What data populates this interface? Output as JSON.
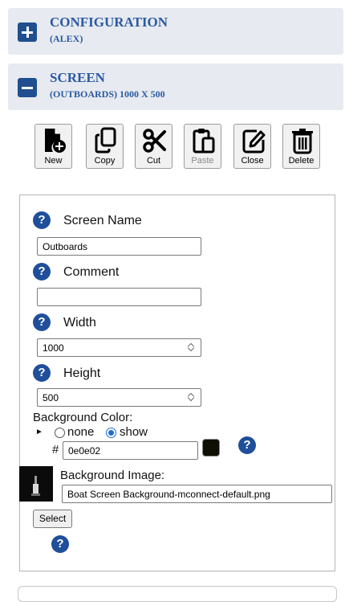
{
  "accordion": {
    "configuration": {
      "title": "CONFIGURATION",
      "subtitle": "(ALEX)",
      "state": "collapsed"
    },
    "screen": {
      "title": "SCREEN",
      "subtitle": "(OUTBOARDS) 1000 X 500",
      "state": "expanded"
    }
  },
  "toolbar": {
    "new_label": "New",
    "copy_label": "Copy",
    "cut_label": "Cut",
    "paste_label": "Paste",
    "close_label": "Close",
    "delete_label": "Delete"
  },
  "form": {
    "help_glyph": "?",
    "screen_name": {
      "label": "Screen Name",
      "value": "Outboards"
    },
    "comment": {
      "label": "Comment",
      "value": ""
    },
    "width": {
      "label": "Width",
      "value": "1000"
    },
    "height": {
      "label": "Height",
      "value": "500"
    },
    "background_color": {
      "label": "Background Color:",
      "expand_glyph": "►",
      "options": [
        "none",
        "show"
      ],
      "selected": "show",
      "hash": "#",
      "value": "0e0e02",
      "swatch_color": "#0e0e02"
    },
    "background_image": {
      "label": "Background Image:",
      "value": "Boat Screen Background-mconnect-default.png",
      "select_label": "Select"
    }
  },
  "colors": {
    "accent": "#1f4f8f",
    "header_bg": "#e7eaf0",
    "title_text": "#2a5aa2"
  }
}
